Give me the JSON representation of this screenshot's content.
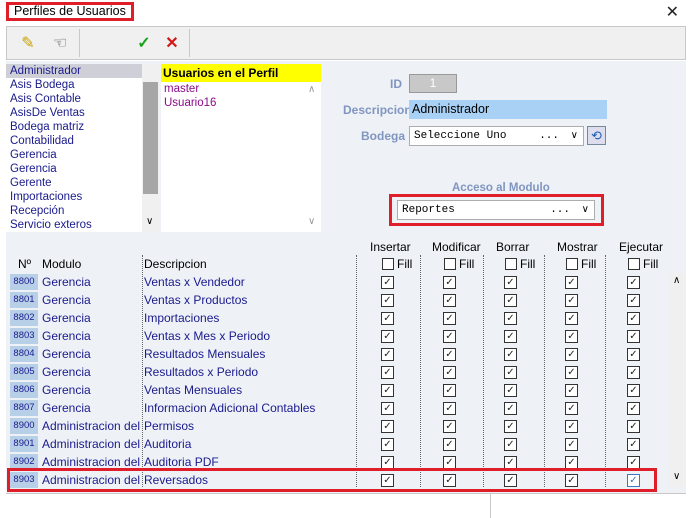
{
  "window": {
    "title": "Perfiles de Usuarios",
    "close": "✕"
  },
  "toolbar": {
    "edit": "✎",
    "pointer": "☜",
    "accept": "✓",
    "cancel": "✕"
  },
  "profiles": [
    "Administrador",
    "Asis Bodega",
    "Asis Contable",
    "AsisDe Ventas",
    "Bodega matriz",
    "Contabilidad",
    "Gerencia",
    "Gerencia",
    "Gerente",
    "Importaciones",
    "Recepción",
    "Servicio exteros"
  ],
  "users": {
    "header": "Usuarios en el Perfil",
    "items": [
      "master",
      "Usuario16"
    ]
  },
  "form": {
    "id_label": "ID",
    "id_value": "1",
    "desc_label": "Descripcion",
    "desc_value": "Administrador",
    "bodega_label": "Bodega",
    "bodega_value": "Seleccione Uno",
    "dots": "...",
    "acceso_label": "Acceso al Modulo",
    "acceso_value": "Reportes"
  },
  "grid": {
    "columns": [
      "Insertar",
      "Modificar",
      "Borrar",
      "Mostrar",
      "Ejecutar"
    ],
    "h_num": "Nº",
    "h_mod": "Modulo",
    "h_desc": "Descripcion",
    "fill": "Fill",
    "rows": [
      {
        "num": "8800",
        "mod": "Gerencia",
        "desc": "Ventas x Vendedor"
      },
      {
        "num": "8801",
        "mod": "Gerencia",
        "desc": "Ventas x Productos"
      },
      {
        "num": "8802",
        "mod": "Gerencia",
        "desc": "Importaciones"
      },
      {
        "num": "8803",
        "mod": "Gerencia",
        "desc": "Ventas x Mes x Periodo"
      },
      {
        "num": "8804",
        "mod": "Gerencia",
        "desc": "Resultados Mensuales"
      },
      {
        "num": "8805",
        "mod": "Gerencia",
        "desc": "Resultados x Periodo"
      },
      {
        "num": "8806",
        "mod": "Gerencia",
        "desc": "Ventas Mensuales"
      },
      {
        "num": "8807",
        "mod": "Gerencia",
        "desc": "Informacion Adicional Contables"
      },
      {
        "num": "8900",
        "mod": "Administracion del",
        "desc": "Permisos"
      },
      {
        "num": "8901",
        "mod": "Administracion del",
        "desc": "Auditoria"
      },
      {
        "num": "8902",
        "mod": "Administracion del",
        "desc": "Auditoria PDF"
      },
      {
        "num": "8903",
        "mod": "Administracion del",
        "desc": "Reversados"
      }
    ]
  }
}
